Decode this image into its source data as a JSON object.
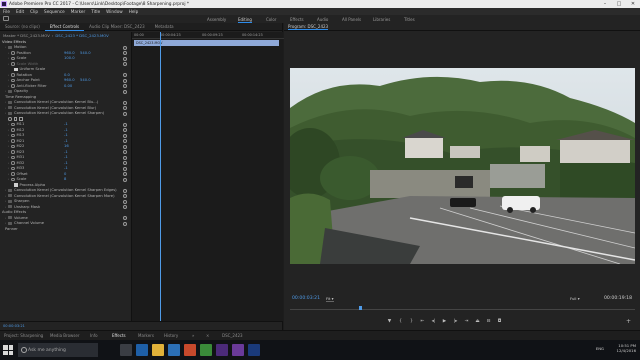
{
  "window": {
    "title": "Adobe Premiere Pro CC 2017 - C:\\Users\\Link\\Desktop\\Footage\\8 Sharpening.prproj *"
  },
  "menu": [
    "File",
    "Edit",
    "Clip",
    "Sequence",
    "Marker",
    "Title",
    "Window",
    "Help"
  ],
  "workspaces": [
    {
      "label": "Assembly",
      "active": false
    },
    {
      "label": "Editing",
      "active": true
    },
    {
      "label": "Color",
      "active": false
    },
    {
      "label": "Effects",
      "active": false
    },
    {
      "label": "Audio",
      "active": false
    },
    {
      "label": "All Panels",
      "active": false
    },
    {
      "label": "Libraries",
      "active": false
    },
    {
      "label": "Titles",
      "active": false
    }
  ],
  "left_tabs": [
    "Source: (no clips)",
    "Effect Controls",
    "Audio Clip Mixer: DSC_2423",
    "Metadata"
  ],
  "effect_controls": {
    "master_label": "Master * DSC_2423.MOV",
    "sequence_link": "DSC_2423 * DSC_2423.MOV",
    "video_effects_label": "Video Effects",
    "ruler": [
      "00:00",
      "00:00:04:23",
      "00:00:09:23",
      "00:00:14:23"
    ],
    "clip_name": "DSC_2423.MOV",
    "rows": [
      {
        "type": "section",
        "label": "Motion",
        "indent": 1
      },
      {
        "type": "prop",
        "label": "Position",
        "val": "960.0",
        "val2": "540.0",
        "indent": 2,
        "stop": true
      },
      {
        "type": "prop",
        "label": "Scale",
        "val": "100.0",
        "indent": 2,
        "stop": true
      },
      {
        "type": "prop",
        "label": "Scale Width",
        "val": "",
        "indent": 2,
        "stop": true,
        "dim": true
      },
      {
        "type": "check",
        "label": "Uniform Scale",
        "indent": 4
      },
      {
        "type": "prop",
        "label": "Rotation",
        "val": "0.0",
        "indent": 2,
        "stop": true
      },
      {
        "type": "prop",
        "label": "Anchor Point",
        "val": "960.0",
        "val2": "540.0",
        "indent": 2,
        "stop": false
      },
      {
        "type": "prop",
        "label": "Anti-flicker Filter",
        "val": "0.00",
        "indent": 2,
        "stop": false
      },
      {
        "type": "section",
        "label": "Opacity",
        "indent": 1
      },
      {
        "type": "plain",
        "label": "Time Remapping",
        "indent": 1
      },
      {
        "type": "section",
        "label": "Convolution Kernel (Convolution Kernel Blu...)",
        "indent": 1
      },
      {
        "type": "section",
        "label": "Convolution Kernel (Convolution Kernel Blur)",
        "indent": 1
      },
      {
        "type": "section",
        "label": "Convolution Kernel (Convolution Kernel Sharpen)",
        "indent": 1
      },
      {
        "type": "shapes",
        "label": "",
        "indent": 2
      },
      {
        "type": "prop",
        "label": "M11",
        "val": "-1",
        "indent": 2,
        "stop": false
      },
      {
        "type": "prop",
        "label": "M12",
        "val": "-1",
        "indent": 2,
        "stop": false
      },
      {
        "type": "prop",
        "label": "M13",
        "val": "-1",
        "indent": 2,
        "stop": false
      },
      {
        "type": "prop",
        "label": "M21",
        "val": "-1",
        "indent": 2,
        "stop": false
      },
      {
        "type": "prop",
        "label": "M22",
        "val": "16",
        "indent": 2,
        "stop": false
      },
      {
        "type": "prop",
        "label": "M23",
        "val": "-1",
        "indent": 2,
        "stop": false
      },
      {
        "type": "prop",
        "label": "M31",
        "val": "-1",
        "indent": 2,
        "stop": false
      },
      {
        "type": "prop",
        "label": "M32",
        "val": "-1",
        "indent": 2,
        "stop": false
      },
      {
        "type": "prop",
        "label": "M33",
        "val": "-1",
        "indent": 2,
        "stop": false
      },
      {
        "type": "prop",
        "label": "Offset",
        "val": "0",
        "indent": 2,
        "stop": false
      },
      {
        "type": "prop",
        "label": "Scale",
        "val": "8",
        "indent": 2,
        "stop": false
      },
      {
        "type": "check",
        "label": "Process Alpha",
        "indent": 4
      },
      {
        "type": "section",
        "label": "Convolution Kernel (Convolution Kernel Sharpen Edges)",
        "indent": 1
      },
      {
        "type": "section",
        "label": "Convolution Kernel (Convolution Kernel Sharpen More)",
        "indent": 1
      },
      {
        "type": "section",
        "label": "Sharpen",
        "indent": 1
      },
      {
        "type": "section",
        "label": "Unsharp Mask",
        "indent": 1
      },
      {
        "type": "header",
        "label": "Audio Effects",
        "indent": 0
      },
      {
        "type": "section",
        "label": "Volume",
        "indent": 1
      },
      {
        "type": "section",
        "label": "Channel Volume",
        "indent": 1
      },
      {
        "type": "plain",
        "label": "Panner",
        "indent": 1
      }
    ],
    "bottom_timecode": "00:00:03:21"
  },
  "program": {
    "tab": "Program: DSC_2423",
    "timecode_current": "00:00:03:21",
    "fit": "Fit",
    "quality": "Full",
    "timecode_duration": "00:00:19:18",
    "progress": 0.2
  },
  "bottom_tabs": [
    {
      "label": "Project: Sharpening",
      "active": false
    },
    {
      "label": "Media Browser",
      "active": false
    },
    {
      "label": "Info",
      "active": false
    },
    {
      "label": "Effects",
      "active": true
    },
    {
      "label": "Markers",
      "active": false
    },
    {
      "label": "History",
      "active": false
    },
    {
      "label": "DSC_2423",
      "active": false
    }
  ],
  "taskbar": {
    "search_placeholder": "Ask me anything",
    "lang": "ENG",
    "time": "10:51 PM",
    "date": "12/4/2016"
  },
  "colors": {
    "accent": "#2d8ceb",
    "value_blue": "#4f9be8"
  }
}
